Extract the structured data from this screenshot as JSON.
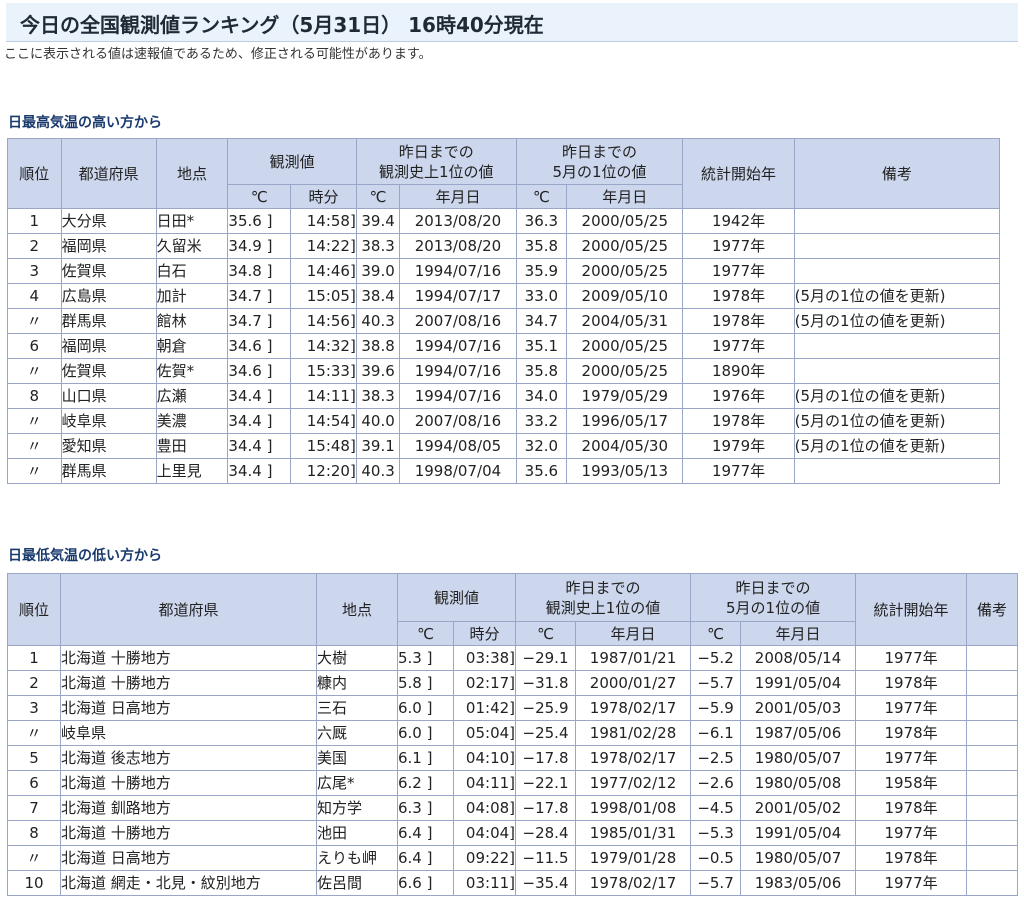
{
  "page": {
    "title": "今日の全国観測値ランキング（5月31日） 16時40分現在",
    "notice": "ここに表示される値は速報値であるため、修正される可能性があります。"
  },
  "header_labels": {
    "rank": "順位",
    "pref": "都道府県",
    "station": "地点",
    "observed": "観測値",
    "record_all": "昨日までの\n観測史上1位の値",
    "record_may": "昨日までの\n5月の1位の値",
    "stat_start": "統計開始年",
    "note": "備考",
    "unit_c": "℃",
    "unit_time": "時分",
    "unit_date": "年月日"
  },
  "high_section": {
    "title": "日最高気温の高い方から",
    "rows": [
      {
        "rank": "1",
        "pref": "大分県",
        "station": "日田*",
        "value": "35.6 ]",
        "time": "14:58]",
        "rec_val": "39.4",
        "rec_date": "2013/08/20",
        "may_val": "36.3",
        "may_date": "2000/05/25",
        "start": "1942年",
        "note": ""
      },
      {
        "rank": "2",
        "pref": "福岡県",
        "station": "久留米",
        "value": "34.9 ]",
        "time": "14:22]",
        "rec_val": "38.3",
        "rec_date": "2013/08/20",
        "may_val": "35.8",
        "may_date": "2000/05/25",
        "start": "1977年",
        "note": ""
      },
      {
        "rank": "3",
        "pref": "佐賀県",
        "station": "白石",
        "value": "34.8 ]",
        "time": "14:46]",
        "rec_val": "39.0",
        "rec_date": "1994/07/16",
        "may_val": "35.9",
        "may_date": "2000/05/25",
        "start": "1977年",
        "note": ""
      },
      {
        "rank": "4",
        "pref": "広島県",
        "station": "加計",
        "value": "34.7 ]",
        "time": "15:05]",
        "rec_val": "38.4",
        "rec_date": "1994/07/17",
        "may_val": "33.0",
        "may_date": "2009/05/10",
        "start": "1978年",
        "note": "(5月の1位の値を更新)"
      },
      {
        "rank": "〃",
        "pref": "群馬県",
        "station": "館林",
        "value": "34.7 ]",
        "time": "14:56]",
        "rec_val": "40.3",
        "rec_date": "2007/08/16",
        "may_val": "34.7",
        "may_date": "2004/05/31",
        "start": "1978年",
        "note": "(5月の1位の値を更新)"
      },
      {
        "rank": "6",
        "pref": "福岡県",
        "station": "朝倉",
        "value": "34.6 ]",
        "time": "14:32]",
        "rec_val": "38.8",
        "rec_date": "1994/07/16",
        "may_val": "35.1",
        "may_date": "2000/05/25",
        "start": "1977年",
        "note": ""
      },
      {
        "rank": "〃",
        "pref": "佐賀県",
        "station": "佐賀*",
        "value": "34.6 ]",
        "time": "15:33]",
        "rec_val": "39.6",
        "rec_date": "1994/07/16",
        "may_val": "35.8",
        "may_date": "2000/05/25",
        "start": "1890年",
        "note": ""
      },
      {
        "rank": "8",
        "pref": "山口県",
        "station": "広瀬",
        "value": "34.4 ]",
        "time": "14:11]",
        "rec_val": "38.3",
        "rec_date": "1994/07/16",
        "may_val": "34.0",
        "may_date": "1979/05/29",
        "start": "1976年",
        "note": "(5月の1位の値を更新)"
      },
      {
        "rank": "〃",
        "pref": "岐阜県",
        "station": "美濃",
        "value": "34.4 ]",
        "time": "14:54]",
        "rec_val": "40.0",
        "rec_date": "2007/08/16",
        "may_val": "33.2",
        "may_date": "1996/05/17",
        "start": "1978年",
        "note": "(5月の1位の値を更新)"
      },
      {
        "rank": "〃",
        "pref": "愛知県",
        "station": "豊田",
        "value": "34.4 ]",
        "time": "15:48]",
        "rec_val": "39.1",
        "rec_date": "1994/08/05",
        "may_val": "32.0",
        "may_date": "2004/05/30",
        "start": "1979年",
        "note": "(5月の1位の値を更新)"
      },
      {
        "rank": "〃",
        "pref": "群馬県",
        "station": "上里見",
        "value": "34.4 ]",
        "time": "12:20]",
        "rec_val": "40.3",
        "rec_date": "1998/07/04",
        "may_val": "35.6",
        "may_date": "1993/05/13",
        "start": "1977年",
        "note": ""
      }
    ]
  },
  "low_section": {
    "title": "日最低気温の低い方から",
    "rows": [
      {
        "rank": "1",
        "pref": "北海道 十勝地方",
        "station": "大樹",
        "value": "5.3 ]",
        "time": "03:38]",
        "rec_val": "−29.1",
        "rec_date": "1987/01/21",
        "may_val": "−5.2",
        "may_date": "2008/05/14",
        "start": "1977年",
        "note": ""
      },
      {
        "rank": "2",
        "pref": "北海道 十勝地方",
        "station": "糠内",
        "value": "5.8 ]",
        "time": "02:17]",
        "rec_val": "−31.8",
        "rec_date": "2000/01/27",
        "may_val": "−5.7",
        "may_date": "1991/05/04",
        "start": "1978年",
        "note": ""
      },
      {
        "rank": "3",
        "pref": "北海道 日高地方",
        "station": "三石",
        "value": "6.0 ]",
        "time": "01:42]",
        "rec_val": "−25.9",
        "rec_date": "1978/02/17",
        "may_val": "−5.9",
        "may_date": "2001/05/03",
        "start": "1977年",
        "note": ""
      },
      {
        "rank": "〃",
        "pref": "岐阜県",
        "station": "六厩",
        "value": "6.0 ]",
        "time": "05:04]",
        "rec_val": "−25.4",
        "rec_date": "1981/02/28",
        "may_val": "−6.1",
        "may_date": "1987/05/06",
        "start": "1978年",
        "note": ""
      },
      {
        "rank": "5",
        "pref": "北海道 後志地方",
        "station": "美国",
        "value": "6.1 ]",
        "time": "04:10]",
        "rec_val": "−17.8",
        "rec_date": "1978/02/17",
        "may_val": "−2.5",
        "may_date": "1980/05/07",
        "start": "1977年",
        "note": ""
      },
      {
        "rank": "6",
        "pref": "北海道 十勝地方",
        "station": "広尾*",
        "value": "6.2 ]",
        "time": "04:11]",
        "rec_val": "−22.1",
        "rec_date": "1977/02/12",
        "may_val": "−2.6",
        "may_date": "1980/05/08",
        "start": "1958年",
        "note": ""
      },
      {
        "rank": "7",
        "pref": "北海道 釧路地方",
        "station": "知方学",
        "value": "6.3 ]",
        "time": "04:08]",
        "rec_val": "−17.8",
        "rec_date": "1998/01/08",
        "may_val": "−4.5",
        "may_date": "2001/05/02",
        "start": "1978年",
        "note": ""
      },
      {
        "rank": "8",
        "pref": "北海道 十勝地方",
        "station": "池田",
        "value": "6.4 ]",
        "time": "04:04]",
        "rec_val": "−28.4",
        "rec_date": "1985/01/31",
        "may_val": "−5.3",
        "may_date": "1991/05/04",
        "start": "1977年",
        "note": ""
      },
      {
        "rank": "〃",
        "pref": "北海道 日高地方",
        "station": "えりも岬",
        "value": "6.4 ]",
        "time": "09:22]",
        "rec_val": "−11.5",
        "rec_date": "1979/01/28",
        "may_val": "−0.5",
        "may_date": "1980/05/07",
        "start": "1978年",
        "note": ""
      },
      {
        "rank": "10",
        "pref": "北海道 網走・北見・紋別地方",
        "station": "佐呂間",
        "value": "6.6 ]",
        "time": "03:11]",
        "rec_val": "−35.4",
        "rec_date": "1978/02/17",
        "may_val": "−5.7",
        "may_date": "1983/05/06",
        "start": "1977年",
        "note": ""
      }
    ]
  }
}
